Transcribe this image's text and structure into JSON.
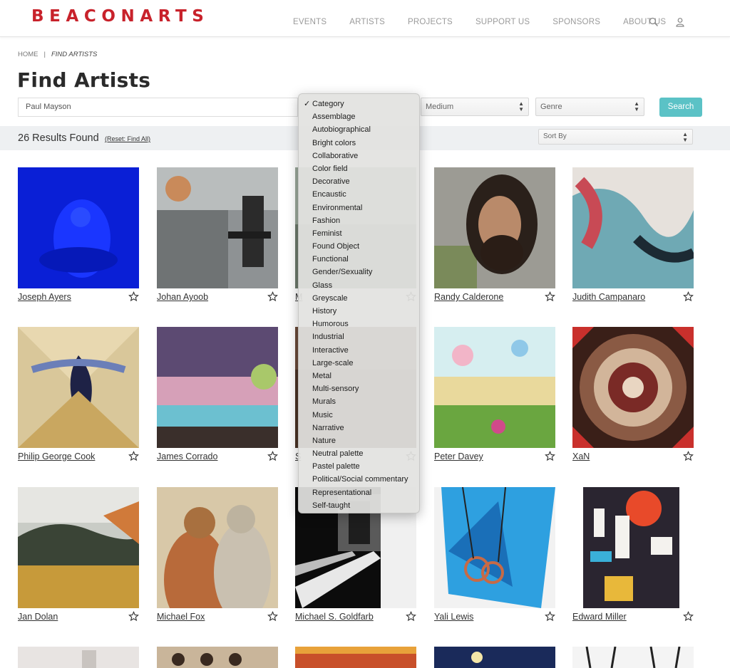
{
  "header": {
    "logo": "BEACONARTS",
    "nav": [
      "EVENTS",
      "ARTISTS",
      "PROJECTS",
      "SUPPORT US",
      "SPONSORS",
      "ABOUT US"
    ]
  },
  "breadcrumb": {
    "home": "HOME",
    "separator": "|",
    "current": "FIND ARTISTS"
  },
  "page_title": "Find Artists",
  "search": {
    "keyword_value": "Paul Mayson",
    "medium_value": "Medium",
    "genre_value": "Genre",
    "button_label": "Search"
  },
  "results": {
    "count_text": "26 Results Found",
    "reset_text": "(Reset: Find All)",
    "sort_value": "Sort By"
  },
  "category_dropdown": {
    "selected": "Category",
    "options": [
      "Category",
      "Assemblage",
      "Autobiographical",
      "Bright colors",
      "Collaborative",
      "Color field",
      "Decorative",
      "Encaustic",
      "Environmental",
      "Fashion",
      "Feminist",
      "Found Object",
      "Functional",
      "Gender/Sexuality",
      "Glass",
      "Greyscale",
      "History",
      "Humorous",
      "Industrial",
      "Interactive",
      "Large-scale",
      "Metal",
      "Multi-sensory",
      "Murals",
      "Music",
      "Narrative",
      "Nature",
      "Neutral palette",
      "Pastel palette",
      "Political/Social commentary",
      "Representational",
      "Self-taught"
    ]
  },
  "artists": [
    {
      "name": "Joseph Ayers"
    },
    {
      "name": "Johan Ayoob"
    },
    {
      "name": "M"
    },
    {
      "name": "Randy Calderone"
    },
    {
      "name": "Judith Campanaro"
    },
    {
      "name": "Philip George Cook"
    },
    {
      "name": "James Corrado"
    },
    {
      "name": "S"
    },
    {
      "name": "Peter Davey"
    },
    {
      "name": "XaN"
    },
    {
      "name": "Jan Dolan"
    },
    {
      "name": "Michael Fox"
    },
    {
      "name": "Michael S. Goldfarb"
    },
    {
      "name": "Yali Lewis"
    },
    {
      "name": "Edward Miller"
    }
  ],
  "colors": {
    "brand": "#c8222b",
    "accent": "#5bc2c6",
    "results_bar": "#eef0f2"
  }
}
